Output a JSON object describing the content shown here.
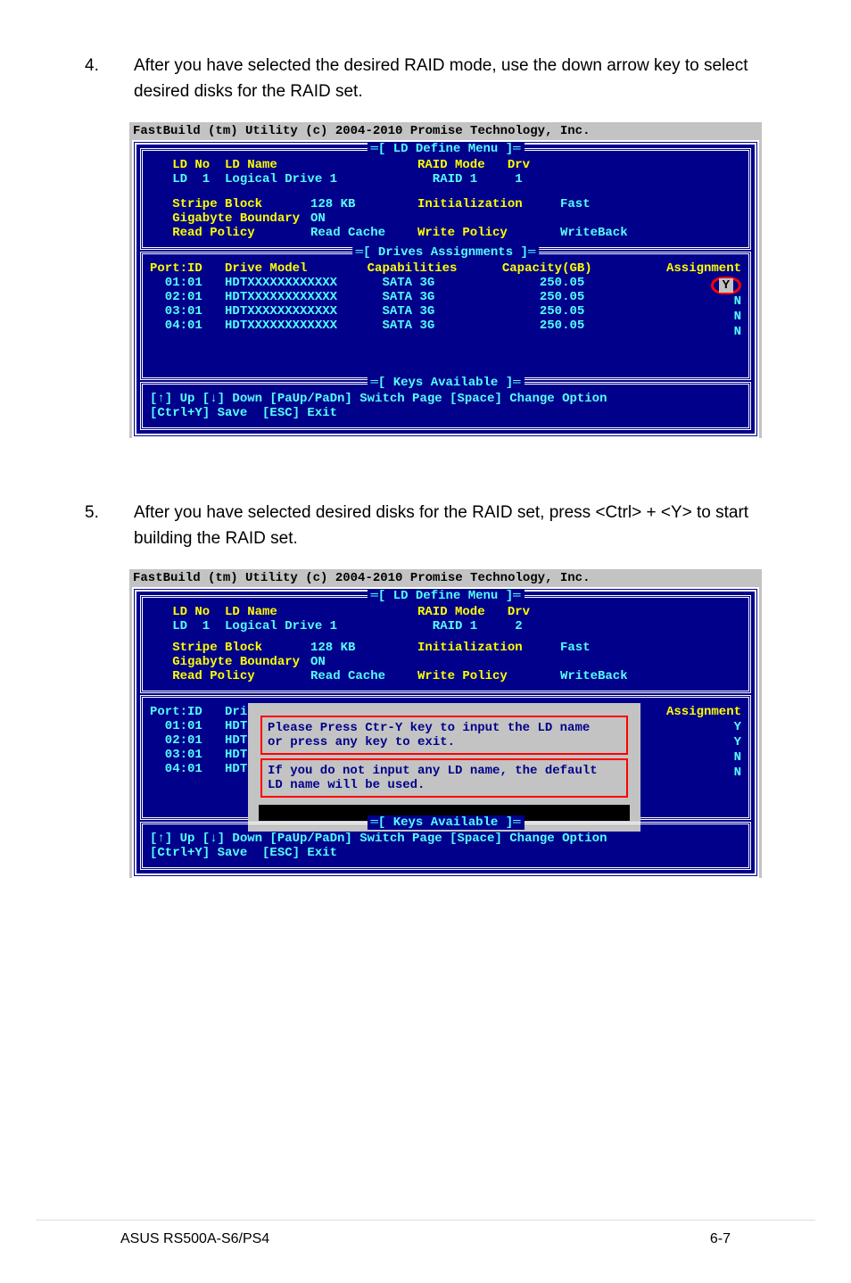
{
  "step4": {
    "num": "4.",
    "text": "After you have selected the desired RAID mode, use the down arrow key to select desired disks for the RAID set."
  },
  "step5": {
    "num": "5.",
    "text": "After you have selected desired disks for the RAID set, press <Ctrl> + <Y> to start building the RAID set."
  },
  "bios1": {
    "title": "FastBuild (tm) Utility (c) 2004-2010 Promise Technology, Inc.",
    "define_title": "═[ LD Define Menu ]═",
    "ld_labels": "   LD No  LD Name",
    "raid_mode_label": "RAID Mode   Drv",
    "ld_row": "   LD  1  Logical Drive 1",
    "raid_val": "  RAID 1     1",
    "stripe_label": "   Stripe Block",
    "stripe_val": "128 KB",
    "init_label": "Initialization",
    "init_val": "Fast",
    "gig_label": "   Gigabyte Boundary",
    "gig_val": "ON",
    "read_label": "   Read Policy",
    "read_val": "Read Cache",
    "write_label": "Write Policy",
    "write_val": "WriteBack",
    "drives_title": "═[ Drives Assignments ]═",
    "drives_header": "Port:ID   Drive Model        Capabilities      Capacity(GB)",
    "assign_header": "Assignment",
    "drive_rows": [
      "  01:01   HDTXXXXXXXXXXXX      SATA 3G              250.05",
      "  02:01   HDTXXXXXXXXXXXX      SATA 3G              250.05",
      "  03:01   HDTXXXXXXXXXXXX      SATA 3G              250.05",
      "  04:01   HDTXXXXXXXXXXXX      SATA 3G              250.05"
    ],
    "assignments": [
      "Y",
      "N",
      "N",
      "N"
    ],
    "keys_title": "═[ Keys Available ]═",
    "keys1": "[↑] Up [↓] Down [PaUp/PaDn] Switch Page [Space] Change Option",
    "keys2": "[Ctrl+Y] Save  [ESC] Exit"
  },
  "bios2": {
    "title": "FastBuild (tm) Utility (c) 2004-2010 Promise Technology, Inc.",
    "define_title": "═[ LD Define Menu ]═",
    "ld_labels": "   LD No  LD Name",
    "raid_mode_label": "RAID Mode   Drv",
    "ld_row": "   LD  1  Logical Drive 1",
    "raid_val": "  RAID 1     2",
    "stripe_label": "   Stripe Block",
    "stripe_val": "128 KB",
    "init_label": "Initialization",
    "init_val": "Fast",
    "gig_label": "   Gigabyte Boundary",
    "gig_val": "ON",
    "read_label": "   Read Policy",
    "read_val": "Read Cache",
    "write_label": "Write Policy",
    "write_val": "WriteBack",
    "drives_left": "Port:ID   Dri\n  01:01   HDT\n  02:01   HDT\n  03:01   HDT\n  04:01   HDT",
    "prompt1": "Please Press Ctr-Y key to input the LD name",
    "prompt2": "or press any key to exit.",
    "prompt3": "If you do not input any LD name, the default",
    "prompt4": "LD name will be used.",
    "assign_header": "Assignment",
    "assignments": [
      "Y",
      "Y",
      "N",
      "N"
    ],
    "keys_title": "═[ Keys Available ]═",
    "keys1": "[↑] Up [↓] Down [PaUp/PaDn] Switch Page [Space] Change Option",
    "keys2": "[Ctrl+Y] Save  [ESC] Exit"
  },
  "footer": {
    "left": "ASUS RS500A-S6/PS4",
    "right": "6-7"
  }
}
